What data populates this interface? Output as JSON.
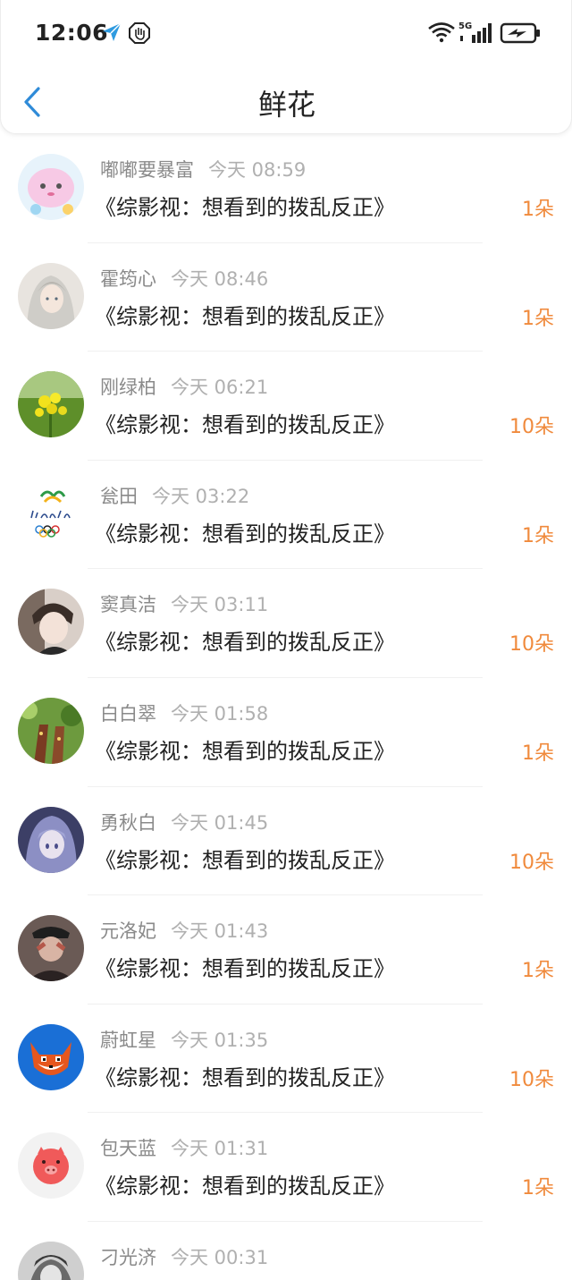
{
  "status_bar": {
    "time": "12:06",
    "network": "5G"
  },
  "header": {
    "title": "鲜花"
  },
  "colors": {
    "accent_blue": "#2f8bd8",
    "count_orange": "#f08a3c"
  },
  "items": [
    {
      "name": "嘟嘟要暴富",
      "time": "今天 08:59",
      "book": "《综影视：想看到的拨乱反正》",
      "count": "1朵"
    },
    {
      "name": "霍筠心",
      "time": "今天 08:46",
      "book": "《综影视：想看到的拨乱反正》",
      "count": "1朵"
    },
    {
      "name": "刚绿柏",
      "time": "今天 06:21",
      "book": "《综影视：想看到的拨乱反正》",
      "count": "10朵"
    },
    {
      "name": "瓮田",
      "time": "今天 03:22",
      "book": "《综影视：想看到的拨乱反正》",
      "count": "1朵"
    },
    {
      "name": "窦真洁",
      "time": "今天 03:11",
      "book": "《综影视：想看到的拨乱反正》",
      "count": "10朵"
    },
    {
      "name": "白白翠",
      "time": "今天 01:58",
      "book": "《综影视：想看到的拨乱反正》",
      "count": "1朵"
    },
    {
      "name": "勇秋白",
      "time": "今天 01:45",
      "book": "《综影视：想看到的拨乱反正》",
      "count": "10朵"
    },
    {
      "name": "元洛妃",
      "time": "今天 01:43",
      "book": "《综影视：想看到的拨乱反正》",
      "count": "1朵"
    },
    {
      "name": "蔚虹星",
      "time": "今天 01:35",
      "book": "《综影视：想看到的拨乱反正》",
      "count": "10朵"
    },
    {
      "name": "包天蓝",
      "time": "今天 01:31",
      "book": "《综影视：想看到的拨乱反正》",
      "count": "1朵"
    },
    {
      "name": "刁光济",
      "time": "今天 00:31",
      "book": "",
      "count": ""
    }
  ]
}
